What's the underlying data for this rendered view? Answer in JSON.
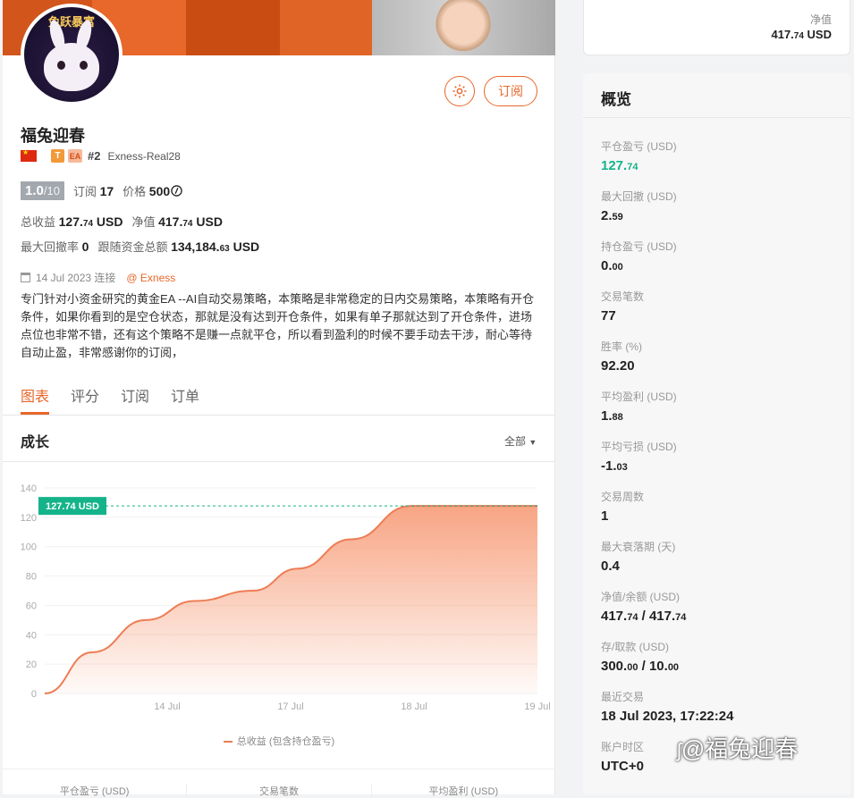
{
  "profile": {
    "avatar_text": "兔跃暴富",
    "name": "福兔迎春",
    "tag_t": "T",
    "tag_ea": "EA",
    "rank": "#2",
    "account": "Exness-Real28",
    "score_main": "1.0",
    "score_max": "/10",
    "subscribe_label": "订阅",
    "subscribers": "17",
    "price_label": "价格",
    "price": "500",
    "total_profit_label": "总收益",
    "total_profit_int": "127.",
    "total_profit_dec": "74",
    "total_profit_unit": "USD",
    "equity_label": "净值",
    "equity_int": "417.",
    "equity_dec": "74",
    "equity_unit": "USD",
    "drawdown_label": "最大回撤率",
    "drawdown": "0",
    "follow_funds_label": "跟随资金总额",
    "follow_funds_int": "134,184.",
    "follow_funds_dec": "63",
    "follow_funds_unit": "USD",
    "connect_date": "14 Jul 2023 连接",
    "broker": "@ Exness",
    "description": "专门针对小资金研究的黄金EA --AI自动交易策略，本策略是非常稳定的日内交易策略，本策略有开仓条件，如果你看到的是空仓状态，那就是没有达到开仓条件，如果有单子那就达到了开仓条件，进场点位也非常不错，还有这个策略不是赚一点就平仓，所以看到盈利的时候不要手动去干涉，耐心等待自动止盈，非常感谢你的订阅，",
    "subscribe_button": "订阅"
  },
  "tabs": [
    "图表",
    "评分",
    "订阅",
    "订单"
  ],
  "growth": {
    "title": "成长",
    "range": "全部"
  },
  "chart_data": {
    "type": "area",
    "x": [
      "14 Jul",
      "17 Jul",
      "18 Jul",
      "19 Jul"
    ],
    "yticks": [
      0,
      20,
      40,
      60,
      80,
      100,
      120,
      140
    ],
    "ylim": [
      0,
      140
    ],
    "series": [
      {
        "name": "总收益 (包含持仓盈亏)",
        "values": [
          0,
          28,
          50,
          63,
          70,
          85,
          105,
          127.74,
          127.74,
          127.74
        ]
      }
    ],
    "last_label": "127.74 USD",
    "colors": {
      "line": "#ee7d55",
      "fill": "#f7a07d",
      "marker": "#15b38a"
    }
  },
  "bottom_stats": [
    "平仓盈亏 (USD)",
    "交易笔数",
    "平均盈利 (USD)"
  ],
  "top_card": {
    "label": "净值",
    "value_int": "417.",
    "value_dec": "74",
    "unit": "USD"
  },
  "overview": {
    "title": "概览",
    "items": [
      {
        "label": "平仓盈亏 (USD)",
        "int": "127.",
        "dec": "74",
        "green": true
      },
      {
        "label": "最大回撤 (USD)",
        "int": "2.",
        "dec": "59"
      },
      {
        "label": "持仓盈亏 (USD)",
        "int": "0.",
        "dec": "00"
      },
      {
        "label": "交易笔数",
        "int": "77",
        "dec": ""
      },
      {
        "label": "胜率 (%)",
        "int": "92.20",
        "dec": ""
      },
      {
        "label": "平均盈利 (USD)",
        "int": "1.",
        "dec": "88"
      },
      {
        "label": "平均亏损 (USD)",
        "int": "-1.",
        "dec": "03"
      },
      {
        "label": "交易周数",
        "int": "1",
        "dec": ""
      },
      {
        "label": "最大衰落期 (天)",
        "int": "0.4",
        "dec": ""
      },
      {
        "label": "净值/余额 (USD)",
        "int": "417.",
        "dec": "74",
        "int2": " / 417.",
        "dec2": "74"
      },
      {
        "label": "存/取款 (USD)",
        "int": "300.",
        "dec": "00",
        "int2": " / 10.",
        "dec2": "00"
      },
      {
        "label": "最近交易",
        "int": "18 Jul 2023, 17:22:24",
        "dec": ""
      },
      {
        "label": "账户时区",
        "int": "UTC+0",
        "dec": ""
      }
    ]
  },
  "watermark": "@福兔迎春"
}
